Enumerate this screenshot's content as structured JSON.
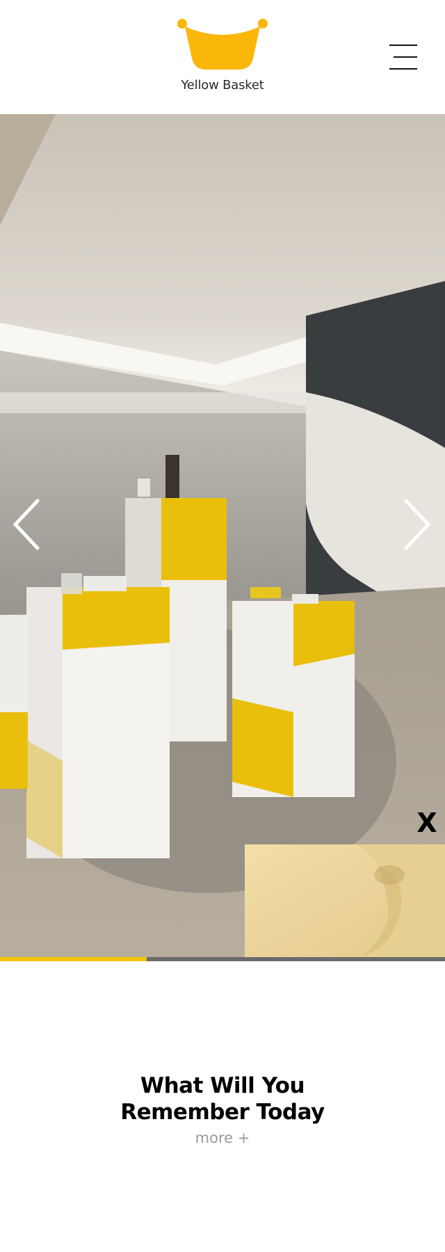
{
  "header": {
    "brand_name": "Yellow Basket",
    "logo_icon": "basket-logo-icon",
    "menu_icon": "hamburger-menu-icon"
  },
  "hero": {
    "prev_icon": "chevron-left-icon",
    "next_icon": "chevron-right-icon",
    "popup_close_label": "X",
    "slide_progress": 0.33,
    "colors": {
      "accent": "#f6c400",
      "track": "#6b6b6b"
    }
  },
  "intro": {
    "title_line1": "What Will You",
    "title_line2": "Remember Today",
    "more_label": "more +"
  },
  "colors": {
    "brand_yellow": "#fbb60a",
    "text_dark": "#111111",
    "muted": "#9a9a9a"
  }
}
